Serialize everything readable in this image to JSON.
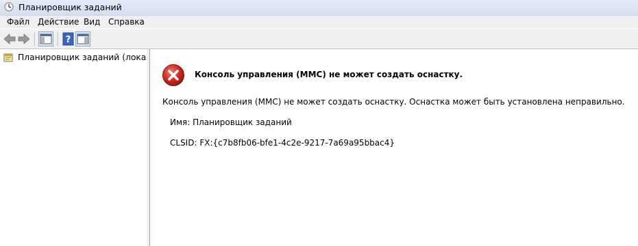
{
  "window": {
    "title": "Планировщик заданий",
    "app_icon": "clock-icon"
  },
  "menu": {
    "items": [
      "Файл",
      "Действие",
      "Вид",
      "Справка"
    ]
  },
  "toolbar": {
    "buttons": [
      "back-arrow-icon",
      "forward-arrow-icon",
      "show-hide-console-tree-icon",
      "help-icon",
      "show-hide-action-pane-icon"
    ]
  },
  "tree": {
    "root_label": "Планировщик заданий (локальный)"
  },
  "error": {
    "heading": "Консоль управления (MMC) не может создать оснастку.",
    "message": "Консоль управления (MMC) не может создать оснастку. Оснастка может быть установлена неправильно.",
    "name_line": "Имя: Планировщик заданий",
    "clsid_line": "CLSID: FX:{c7b8fb06-bfe1-4c2e-9217-7a69a95bbac4}"
  },
  "colors": {
    "error_red": "#c8201a",
    "titlebar": "#dbe6f4",
    "chrome": "#f0f0f0"
  }
}
